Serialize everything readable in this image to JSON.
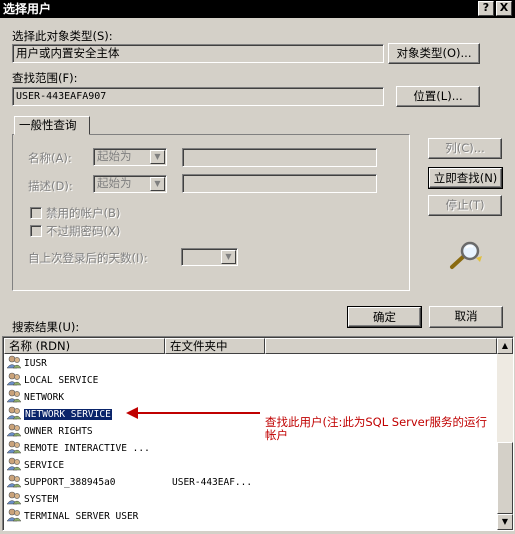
{
  "window": {
    "title": "选择用户",
    "help_btn": "?",
    "close_btn": "X"
  },
  "object_type": {
    "label": "选择此对象类型(S):",
    "value": "用户或内置安全主体",
    "button": "对象类型(O)..."
  },
  "location": {
    "label": "查找范围(F):",
    "value": "USER-443EAFA907",
    "button": "位置(L)..."
  },
  "query": {
    "tab": "一般性查询",
    "name_label": "名称(A):",
    "name_mode": "起始为",
    "desc_label": "描述(D):",
    "desc_mode": "起始为",
    "disabled_accounts": "禁用的帐户(B)",
    "no_expire_pwd": "不过期密码(X)",
    "days_label": "自上次登录后的天数(I):",
    "columns_btn": "列(C)...",
    "find_now_btn": "立即查找(N)",
    "stop_btn": "停止(T)"
  },
  "actions": {
    "ok": "确定",
    "cancel": "取消"
  },
  "results": {
    "label": "搜索结果(U):",
    "columns": [
      "名称 (RDN)",
      "在文件夹中"
    ],
    "rows": [
      {
        "name": "IUSR",
        "folder": ""
      },
      {
        "name": "LOCAL SERVICE",
        "folder": ""
      },
      {
        "name": "NETWORK",
        "folder": ""
      },
      {
        "name": "NETWORK SERVICE",
        "folder": ""
      },
      {
        "name": "OWNER RIGHTS",
        "folder": ""
      },
      {
        "name": "REMOTE INTERACTIVE ...",
        "folder": ""
      },
      {
        "name": "SERVICE",
        "folder": ""
      },
      {
        "name": "SUPPORT_388945a0",
        "folder": "USER-443EAF..."
      },
      {
        "name": "SYSTEM",
        "folder": ""
      },
      {
        "name": "TERMINAL SERVER USER",
        "folder": ""
      }
    ],
    "selected_index": 3
  },
  "annotation": {
    "line1": "查找此用户(注:此为SQL  Server服务的运行",
    "line2": "帐户",
    "color": "#c00000"
  }
}
